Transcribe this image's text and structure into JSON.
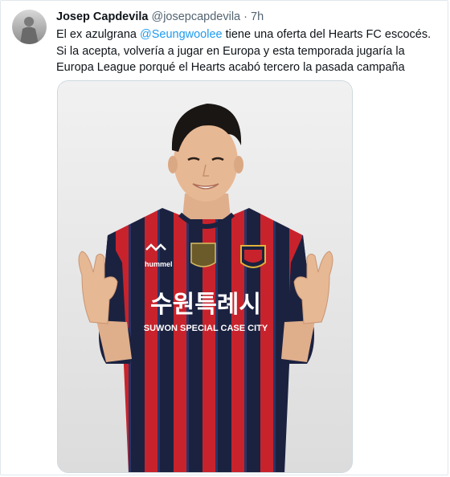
{
  "tweet": {
    "author_name": "Josep Capdevila",
    "author_handle": "@josepcapdevila",
    "separator": "·",
    "time": "7h",
    "text_parts": {
      "before": "El ex azulgrana ",
      "mention": "@Seungwoolee",
      "after": " tiene una oferta del Hearts FC escocés. Si la acepta, volvería a jugar en Europa y esta temporada jugaría la Europa League porqué el Hearts acabó tercero la pasada campaña"
    }
  },
  "photo": {
    "jersey_korean": "수원특례시",
    "jersey_sponsor": "SUWON SPECIAL CASE CITY",
    "brand": "hummel",
    "icon": "person-photo",
    "colors": {
      "red": "#c8232c",
      "navy": "#1b2240",
      "skin": "#e7b894",
      "hair": "#1a1614"
    }
  }
}
